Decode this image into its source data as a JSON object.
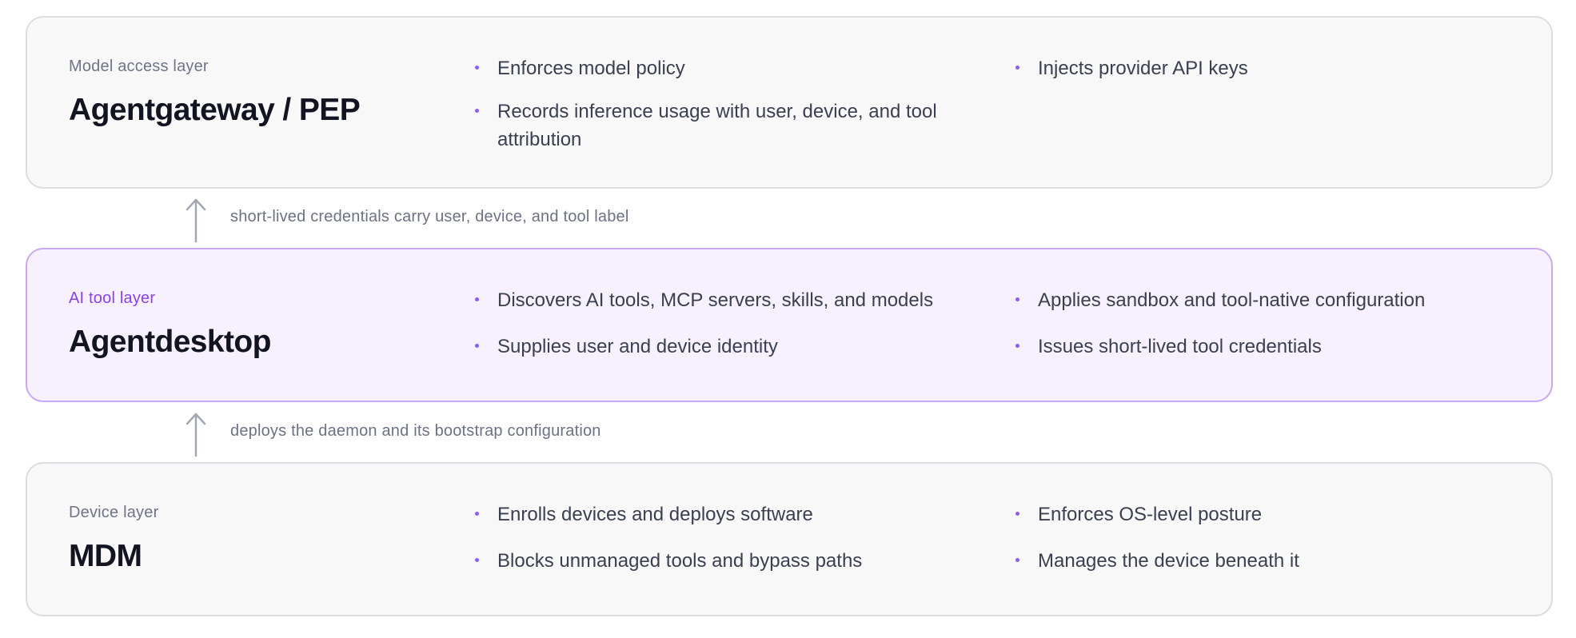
{
  "layers": {
    "model": {
      "eyebrow": "Model access layer",
      "title": "Agentgateway / PEP",
      "col1": [
        "Enforces model policy",
        "Records inference usage with user, device, and tool attribution"
      ],
      "col2": [
        "Injects provider API keys"
      ]
    },
    "tool": {
      "eyebrow": "AI tool layer",
      "title": "Agentdesktop",
      "col1": [
        "Discovers AI tools, MCP servers, skills, and models",
        "Supplies user and device identity"
      ],
      "col2": [
        "Applies sandbox and tool-native configuration",
        "Issues short-lived tool credentials"
      ]
    },
    "device": {
      "eyebrow": "Device layer",
      "title": "MDM",
      "col1": [
        "Enrolls devices and deploys software",
        "Blocks unmanaged tools and bypass paths"
      ],
      "col2": [
        "Enforces OS-level posture",
        "Manages the device beneath it"
      ]
    }
  },
  "connectors": {
    "tool_to_model": "short-lived credentials carry user, device, and tool label",
    "device_to_tool": "deploys the daemon and its bootstrap configuration"
  },
  "icons": {
    "arrow": "arrow-up-icon",
    "bullet": "bullet-dot-icon"
  },
  "colors": {
    "accent": "#8b5cf6",
    "highlight_border": "#c9a8f2",
    "highlight_bg": "#f7f1fe",
    "panel_bg": "#f8f8f9",
    "panel_border": "#dcdde2"
  }
}
